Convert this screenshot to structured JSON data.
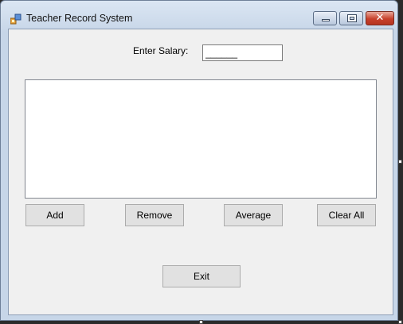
{
  "window": {
    "title": "Teacher Record System",
    "controls": {
      "minimize": "minimize",
      "maximize": "maximize",
      "close": "✕"
    }
  },
  "form": {
    "salary_label": "Enter Salary:",
    "salary_value": "______",
    "list_items": []
  },
  "buttons": {
    "add": "Add",
    "remove": "Remove",
    "average": "Average",
    "clear_all": "Clear All",
    "exit": "Exit"
  },
  "colors": {
    "client_background": "#f0f0f0",
    "button_face": "#e1e1e1",
    "close_button": "#c7402c"
  }
}
